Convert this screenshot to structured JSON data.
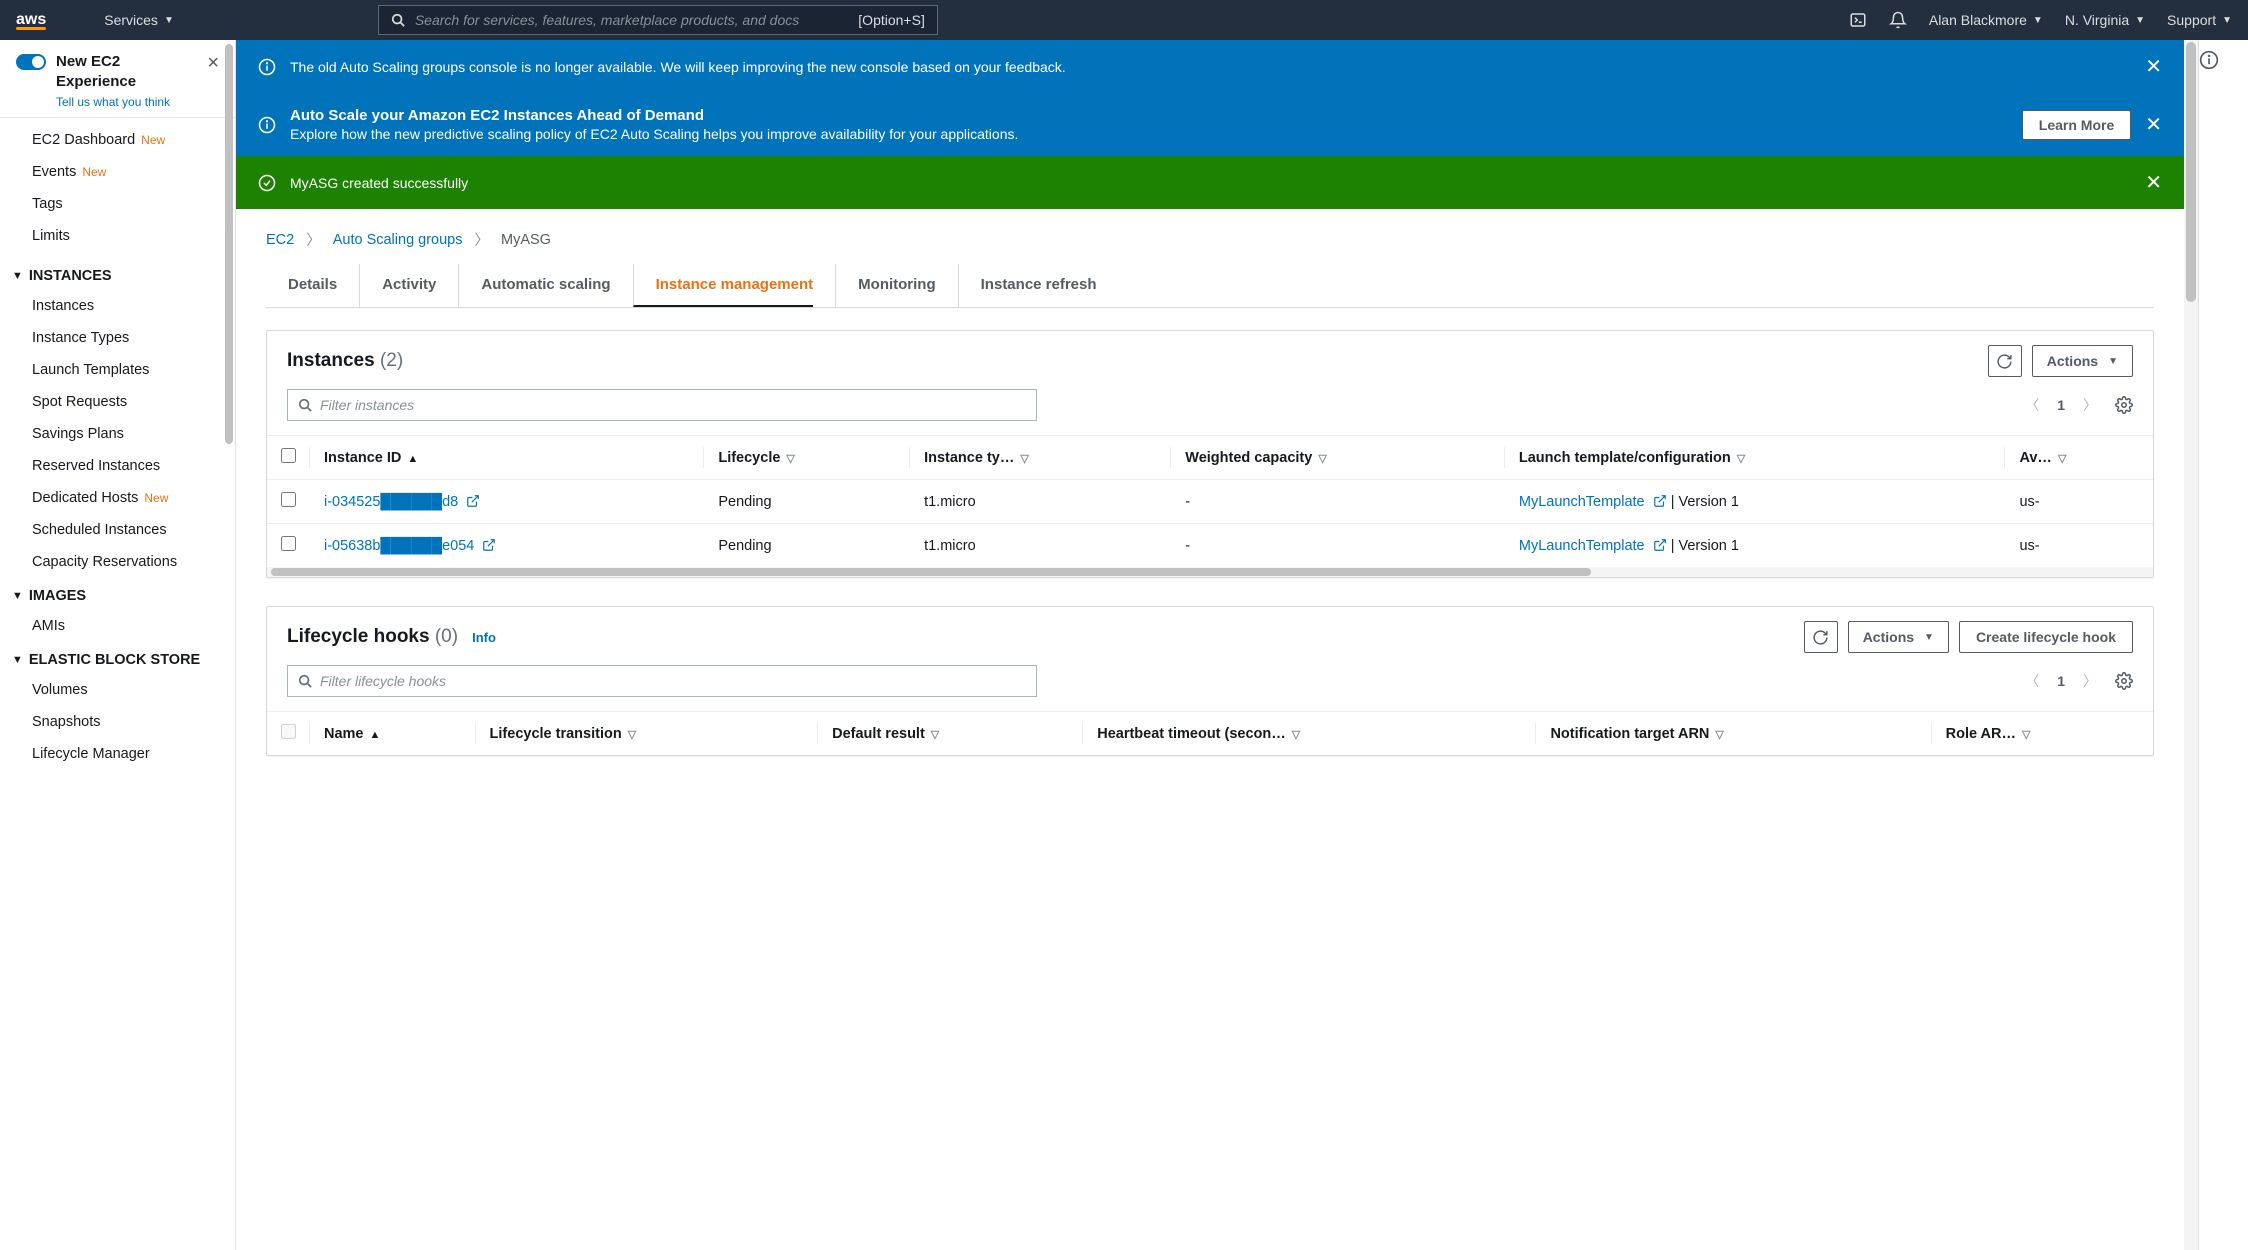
{
  "topnav": {
    "logo": "aws",
    "services": "Services",
    "search_placeholder": "Search for services, features, marketplace products, and docs",
    "search_shortcut": "[Option+S]",
    "user": "Alan Blackmore",
    "region": "N. Virginia",
    "support": "Support"
  },
  "new_experience": {
    "title_line1": "New EC2",
    "title_line2": "Experience",
    "feedback": "Tell us what you think"
  },
  "sidebar": {
    "top": [
      {
        "label": "EC2 Dashboard",
        "new": true
      },
      {
        "label": "Events",
        "new": true
      },
      {
        "label": "Tags",
        "new": false
      },
      {
        "label": "Limits",
        "new": false
      }
    ],
    "groups": [
      {
        "header": "INSTANCES",
        "items": [
          {
            "label": "Instances"
          },
          {
            "label": "Instance Types"
          },
          {
            "label": "Launch Templates"
          },
          {
            "label": "Spot Requests"
          },
          {
            "label": "Savings Plans"
          },
          {
            "label": "Reserved Instances"
          },
          {
            "label": "Dedicated Hosts",
            "new": true
          },
          {
            "label": "Scheduled Instances"
          },
          {
            "label": "Capacity Reservations"
          }
        ]
      },
      {
        "header": "IMAGES",
        "items": [
          {
            "label": "AMIs"
          }
        ]
      },
      {
        "header": "ELASTIC BLOCK STORE",
        "items": [
          {
            "label": "Volumes"
          },
          {
            "label": "Snapshots"
          },
          {
            "label": "Lifecycle Manager"
          }
        ]
      }
    ]
  },
  "banners": {
    "old_console": "The old Auto Scaling groups console is no longer available. We will keep improving the new console based on your feedback.",
    "predictive_title": "Auto Scale your Amazon EC2 Instances Ahead of Demand",
    "predictive_body": "Explore how the new predictive scaling policy of EC2 Auto Scaling helps you improve availability for your applications.",
    "learn_more": "Learn More",
    "success": "MyASG created successfully"
  },
  "breadcrumbs": {
    "ec2": "EC2",
    "asg": "Auto Scaling groups",
    "current": "MyASG"
  },
  "tabs": [
    {
      "label": "Details"
    },
    {
      "label": "Activity"
    },
    {
      "label": "Automatic scaling"
    },
    {
      "label": "Instance management",
      "active": true
    },
    {
      "label": "Monitoring"
    },
    {
      "label": "Instance refresh"
    }
  ],
  "instances_panel": {
    "title": "Instances",
    "count": "(2)",
    "actions": "Actions",
    "filter_placeholder": "Filter instances",
    "page": "1",
    "columns": [
      "Instance ID",
      "Lifecycle",
      "Instance ty…",
      "Weighted capacity",
      "Launch template/configuration",
      "Av…"
    ],
    "rows": [
      {
        "id": "i-034525██████d8",
        "lifecycle": "Pending",
        "type": "t1.micro",
        "weighted": "-",
        "lt": "MyLaunchTemplate",
        "lt_suffix": " | Version 1",
        "az": "us-"
      },
      {
        "id": "i-05638b██████e054",
        "lifecycle": "Pending",
        "type": "t1.micro",
        "weighted": "-",
        "lt": "MyLaunchTemplate",
        "lt_suffix": " | Version 1",
        "az": "us-"
      }
    ]
  },
  "hooks_panel": {
    "title": "Lifecycle hooks",
    "count": "(0)",
    "info": "Info",
    "actions": "Actions",
    "create": "Create lifecycle hook",
    "filter_placeholder": "Filter lifecycle hooks",
    "page": "1",
    "columns": [
      "Name",
      "Lifecycle transition",
      "Default result",
      "Heartbeat timeout (secon…",
      "Notification target ARN",
      "Role AR…"
    ]
  }
}
